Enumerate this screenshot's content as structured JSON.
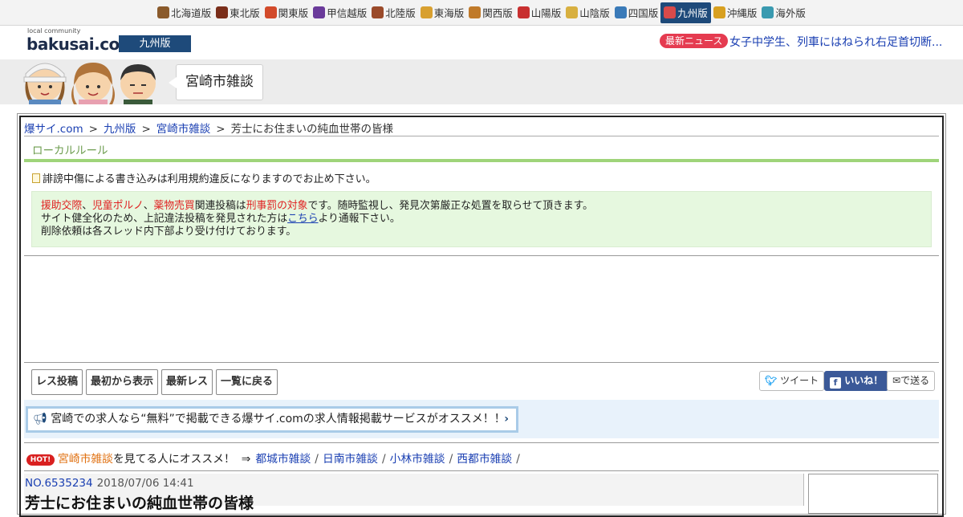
{
  "regions": [
    {
      "label": "北海道版",
      "icon": "hokkaido-icon",
      "color": "#8a5a2b",
      "active": false
    },
    {
      "label": "東北版",
      "icon": "tohoku-icon",
      "color": "#7a2e1a",
      "active": false
    },
    {
      "label": "関東版",
      "icon": "kanto-icon",
      "color": "#d24a2a",
      "active": false
    },
    {
      "label": "甲信越版",
      "icon": "koshinetsu-icon",
      "color": "#6a3a9a",
      "active": false
    },
    {
      "label": "北陸版",
      "icon": "hokuriku-icon",
      "color": "#9a4a2a",
      "active": false
    },
    {
      "label": "東海版",
      "icon": "tokai-icon",
      "color": "#d8a030",
      "active": false
    },
    {
      "label": "関西版",
      "icon": "kansai-icon",
      "color": "#c07a2a",
      "active": false
    },
    {
      "label": "山陽版",
      "icon": "sanyo-icon",
      "color": "#c83030",
      "active": false
    },
    {
      "label": "山陰版",
      "icon": "sanin-icon",
      "color": "#d8b040",
      "active": false
    },
    {
      "label": "四国版",
      "icon": "shikoku-icon",
      "color": "#3a7ab8",
      "active": false
    },
    {
      "label": "九州版",
      "icon": "kyushu-icon",
      "color": "#d84a4a",
      "active": true
    },
    {
      "label": "沖縄版",
      "icon": "okinawa-icon",
      "color": "#d8a020",
      "active": false
    },
    {
      "label": "海外版",
      "icon": "overseas-icon",
      "color": "#3a9ab0",
      "active": false
    }
  ],
  "header": {
    "logo_small": "local community",
    "logo_main": "bakusai.com",
    "edition": "九州版",
    "news_label": "最新ニュース",
    "news_text": "女子中学生、列車にはねられ右足首切断..."
  },
  "banner": {
    "board_title": "宮崎市雑談"
  },
  "breadcrumb": [
    {
      "label": "爆サイ.com",
      "link": true
    },
    {
      "label": "九州版",
      "link": true
    },
    {
      "label": "宮崎市雑談",
      "link": true
    },
    {
      "label": "芳士にお住まいの純血世帯の皆様",
      "link": false
    }
  ],
  "local_rule": {
    "heading": "ローカルルール",
    "line": "誹謗中傷による書き込みは利用規約違反になりますのでお止め下さい。"
  },
  "warning": {
    "w1": "援助交際",
    "sep1": "、",
    "w2": "児童ポルノ",
    "sep2": "、",
    "w3": "薬物売買",
    "mid1": "関連投稿は",
    "w4": "刑事罰の対象",
    "end1": "です。随時監視し、発見次第厳正な処置を取らせて頂きます。",
    "line2_pre": "サイト健全化のため、上記違法投稿を発見された方は",
    "line2_link": "こちら",
    "line2_post": "より通報下さい。",
    "line3": "削除依頼は各スレッド内下部より受け付けております。"
  },
  "actions": {
    "post": "レス投稿",
    "from_start": "最初から表示",
    "latest": "最新レス",
    "back": "一覧に戻る"
  },
  "share": {
    "tweet": "ツイート",
    "like": "いいね！",
    "send": "で送る"
  },
  "promo": {
    "text": "宮崎での求人なら“無料”で掲載できる爆サイ.comの求人情報掲載サービスがオススメ！！"
  },
  "recommend": {
    "badge": "HOT!",
    "board": "宮崎市雑談",
    "text": "を見てる人にオススメ！",
    "arrow": "⇒",
    "links": [
      "都城市雑談",
      "日南市雑談",
      "小林市雑談",
      "西都市雑談"
    ]
  },
  "thread": {
    "no": "NO.6535234",
    "date": "2018/07/06 14:41",
    "title": "芳士にお住まいの純血世帯の皆様"
  }
}
